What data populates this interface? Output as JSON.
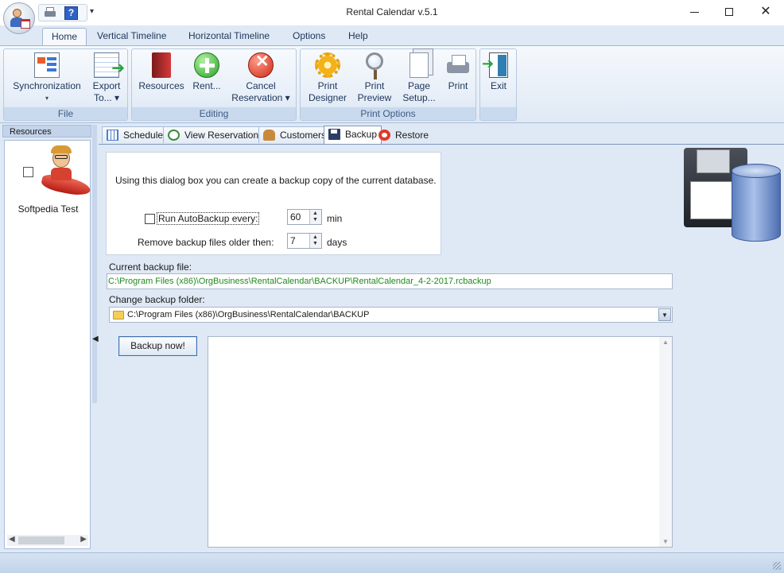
{
  "window": {
    "title": "Rental Calendar v.5.1",
    "controls": {
      "minimize": "",
      "maximize": "",
      "close": "✕"
    }
  },
  "quick_access": {
    "more": "▾"
  },
  "ribbon": {
    "tabs": [
      {
        "label": "Home",
        "active": true
      },
      {
        "label": "Vertical Timeline"
      },
      {
        "label": "Horizontal Timeline"
      },
      {
        "label": "Options"
      },
      {
        "label": "Help"
      }
    ],
    "groups": {
      "file": {
        "label": "File",
        "buttons": [
          {
            "label1": "Synchronization",
            "label2": "▾",
            "icon": "synchronization-icon"
          },
          {
            "label1": "Export",
            "label2": "To... ▾",
            "icon": "export-icon"
          }
        ]
      },
      "editing": {
        "label": "Editing",
        "buttons": [
          {
            "label1": "Resources",
            "label2": "",
            "icon": "resources-icon"
          },
          {
            "label1": "Rent...",
            "label2": "",
            "icon": "rent-icon"
          },
          {
            "label1": "Cancel",
            "label2": "Reservation ▾",
            "icon": "cancel-reservation-icon"
          }
        ]
      },
      "print": {
        "label": "Print Options",
        "buttons": [
          {
            "label1": "Print",
            "label2": "Designer",
            "icon": "print-designer-icon"
          },
          {
            "label1": "Print",
            "label2": "Preview",
            "icon": "print-preview-icon"
          },
          {
            "label1": "Page",
            "label2": "Setup...",
            "icon": "page-setup-icon"
          },
          {
            "label1": "Print",
            "label2": "",
            "icon": "printer-icon"
          }
        ]
      },
      "exit": {
        "label": "",
        "buttons": [
          {
            "label1": "Exit",
            "label2": "",
            "icon": "exit-icon"
          }
        ]
      }
    }
  },
  "resources_panel": {
    "header": "Resources",
    "items": [
      {
        "name": "Softpedia Test",
        "checked": false
      }
    ]
  },
  "content_tabs": [
    {
      "label": "Scheduler",
      "icon": "scheduler-icon"
    },
    {
      "label": "View Reservations",
      "icon": "clock-icon"
    },
    {
      "label": "Customers",
      "icon": "customers-icon"
    },
    {
      "label": "Backup",
      "icon": "floppy-icon",
      "active": true
    },
    {
      "label": "Restore",
      "icon": "lifebuoy-icon"
    }
  ],
  "backup": {
    "intro": "Using this dialog box you can create a backup copy of the current database.",
    "autobackup_label": "Run AutoBackup every:",
    "autobackup_checked": false,
    "autobackup_value": "60",
    "autobackup_unit": "min",
    "remove_label": "Remove backup files older then:",
    "remove_value": "7",
    "remove_unit": "days",
    "current_file_label": "Current backup file:",
    "current_file_value": "C:\\Program Files (x86)\\OrgBusiness\\RentalCalendar\\BACKUP\\RentalCalendar_4-2-2017.rcbackup",
    "folder_label": "Change backup folder:",
    "folder_value": "C:\\Program Files (x86)\\OrgBusiness\\RentalCalendar\\BACKUP",
    "backup_button": "Backup now!",
    "log_text": ""
  },
  "colors": {
    "ribbon_bg": "#dfe9f5",
    "group_label_bg": "#c9daef",
    "path_text": "#1f8a1f",
    "focus_border": "#3f6fa9"
  }
}
